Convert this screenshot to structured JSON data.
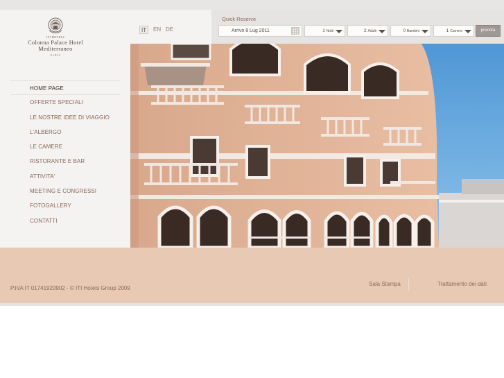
{
  "brand": {
    "small_text": "ITI HOTELS",
    "name_line1": "Colonna Palace Hotel",
    "name_line2": "Mediterraneo",
    "location": "OLBIA"
  },
  "nav": {
    "items": [
      {
        "label": "HOME PAGE",
        "active": true
      },
      {
        "label": "OFFERTE SPECIALI"
      },
      {
        "label": "LE NOSTRE IDEE DI VIAGGIO"
      },
      {
        "label": "L'ALBERGO"
      },
      {
        "label": "LE CAMERE"
      },
      {
        "label": "RISTORANTE E BAR"
      },
      {
        "label": "ATTIVITA'"
      },
      {
        "label": "MEETING E CONGRESSI"
      },
      {
        "label": "FOTOGALLERY"
      },
      {
        "label": "CONTATTI"
      }
    ]
  },
  "languages": [
    "IT",
    "EN",
    "DE"
  ],
  "quick_reserve": {
    "title": "Quick Reserve",
    "arrival": "Arrivo 8 Lug 2011",
    "nights_value": "1",
    "nights_label": "Notti",
    "adults_value": "2",
    "adults_label": "Adulti",
    "children_value": "0",
    "children_label": "Bambini",
    "rooms_value": "1",
    "rooms_label": "Camere",
    "book_label": "prenota"
  },
  "footer": {
    "copyright": "P.IVA IT 01741920902 - © ITI Hotels Group 2009",
    "links": [
      "Sala Stampa",
      "Trattamento dei dati"
    ]
  },
  "colors": {
    "footer_bg": "#e7c9b4",
    "sidebar_bg": "#f4f3f2",
    "nav_text": "#8a6658"
  }
}
